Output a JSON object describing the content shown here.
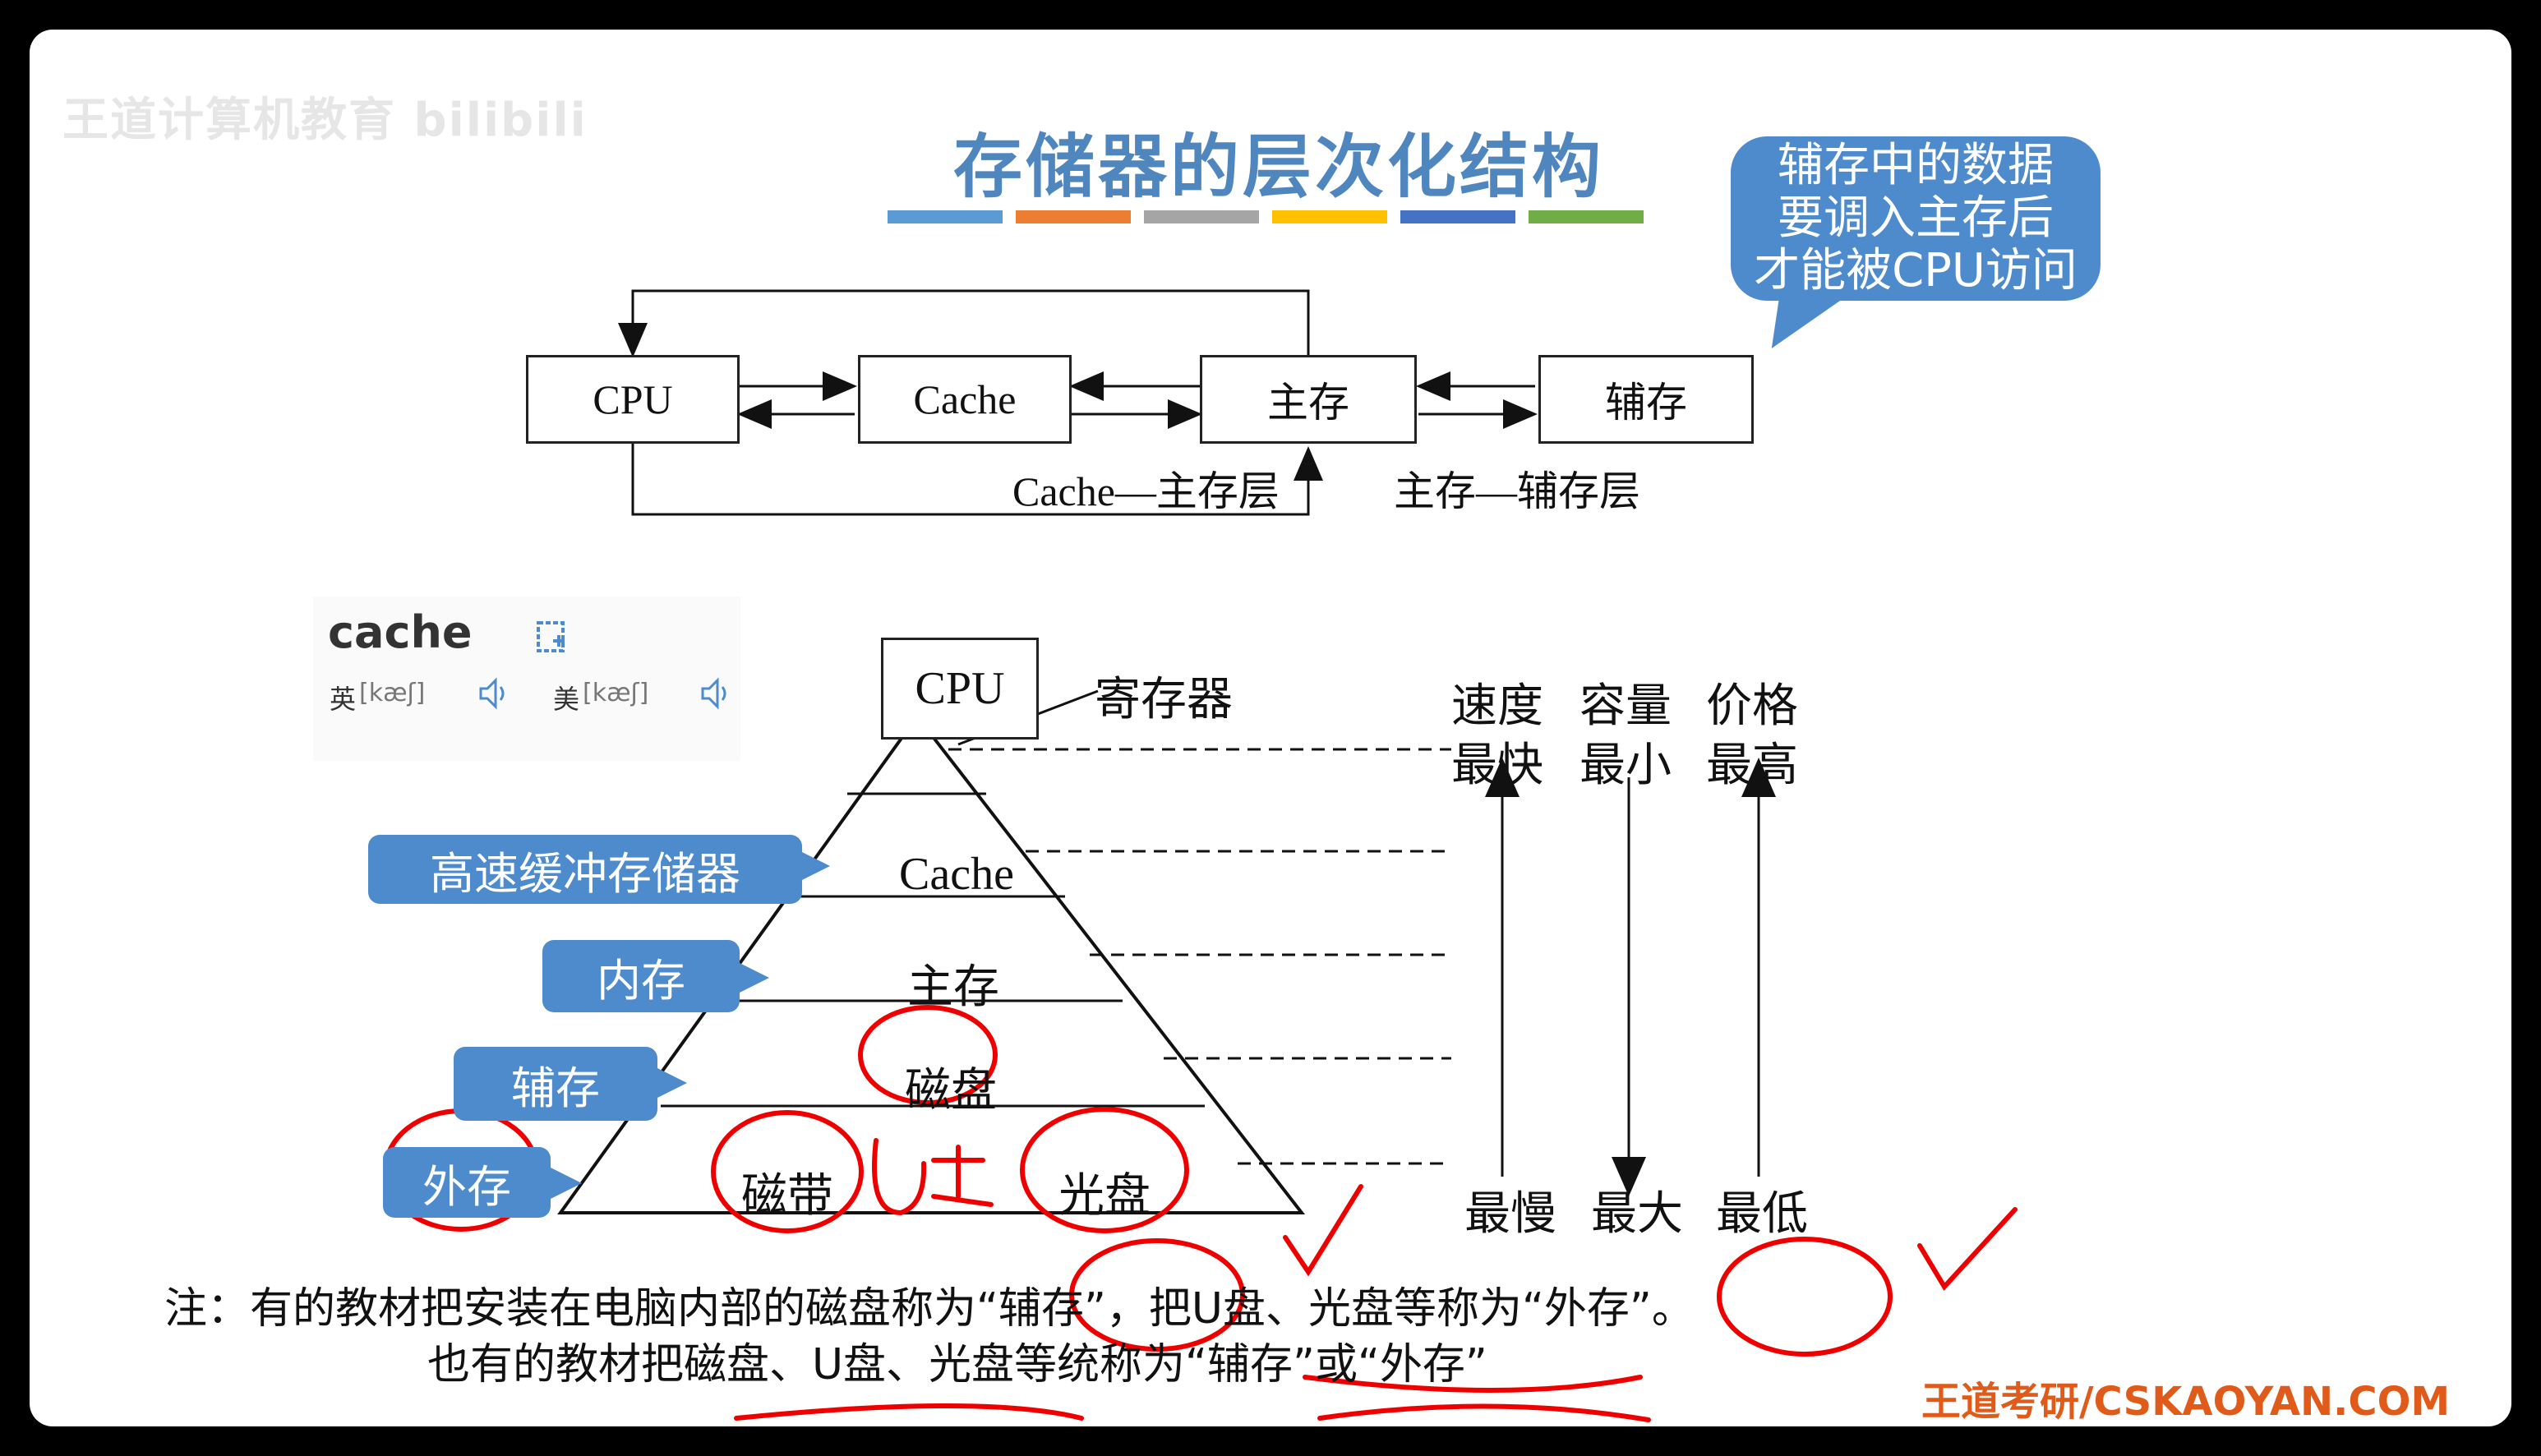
{
  "watermark": "王道计算机教育 bilibili",
  "title": "存储器的层次化结构",
  "title_bar_colors": [
    "#5b9bd5",
    "#ed7d31",
    "#a5a5a5",
    "#ffc000",
    "#4472c4",
    "#70ad47"
  ],
  "callout": {
    "line1": "辅存中的数据",
    "line2": "要调入主存后",
    "line3": "才能被CPU访问"
  },
  "top_diagram": {
    "cpu": "CPU",
    "cache": "Cache",
    "main": "主存",
    "aux": "辅存",
    "label_cache_main": "Cache—主存层",
    "label_main_aux": "主存—辅存层"
  },
  "dictionary": {
    "word": "cache",
    "uk_label": "英",
    "uk_phonetic": "[kæʃ]",
    "us_label": "美",
    "us_phonetic": "[kæʃ]"
  },
  "pyramid": {
    "top": "CPU",
    "register_label": "寄存器",
    "layer_cache": "Cache",
    "layer_main": "主存",
    "layer_disk": "磁盘",
    "layer_tape": "磁带",
    "layer_optical": "光盘",
    "handwritten_u": "U盘"
  },
  "side_tags": {
    "cache_tag": "高速缓冲存储器",
    "main_tag": "内存",
    "aux_tag": "辅存",
    "ext_tag": "外存"
  },
  "scale": {
    "speed": "速度",
    "capacity": "容量",
    "price": "价格",
    "speed_top": "最快",
    "capacity_top": "最小",
    "price_top": "最高",
    "speed_bottom": "最慢",
    "capacity_bottom": "最大",
    "price_bottom": "最低"
  },
  "notes": {
    "line1": "注：有的教材把安装在电脑内部的磁盘称为“辅存”，把U盘、光盘等称为“外存”。",
    "line2": "也有的教材把磁盘、U盘、光盘等统称为“辅存”或“外存”"
  },
  "footer": "王道考研/CSKAOYAN.COM"
}
